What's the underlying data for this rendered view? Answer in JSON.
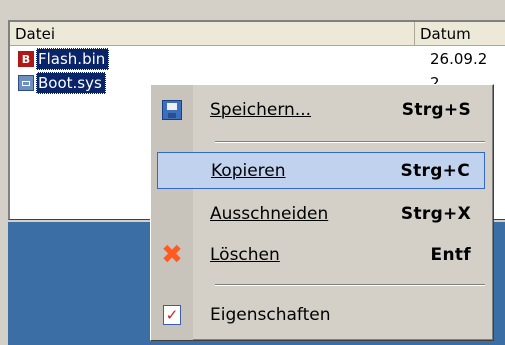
{
  "columns": {
    "name": "Datei",
    "date": "Datum"
  },
  "files": [
    {
      "name": "Flash.bin",
      "date": "26.09.2",
      "icon": "bin-file-icon"
    },
    {
      "name": "Boot.sys",
      "date": "2",
      "icon": "sys-file-icon"
    }
  ],
  "menu": {
    "save": {
      "label": "Speichern...",
      "shortcut": "Strg+S",
      "icon": "save-disk-icon"
    },
    "copy": {
      "label": "Kopieren",
      "shortcut": "Strg+C"
    },
    "cut": {
      "label": "Ausschneiden",
      "shortcut": "Strg+X"
    },
    "delete": {
      "label": "Löschen",
      "shortcut": "Entf",
      "icon": "delete-x-icon"
    },
    "props": {
      "label": "Eigenschaften",
      "icon": "properties-icon"
    }
  },
  "colors": {
    "selection": "#0a246a",
    "menu_highlight": "#c1d2ee",
    "desktop": "#3a6ea5"
  }
}
